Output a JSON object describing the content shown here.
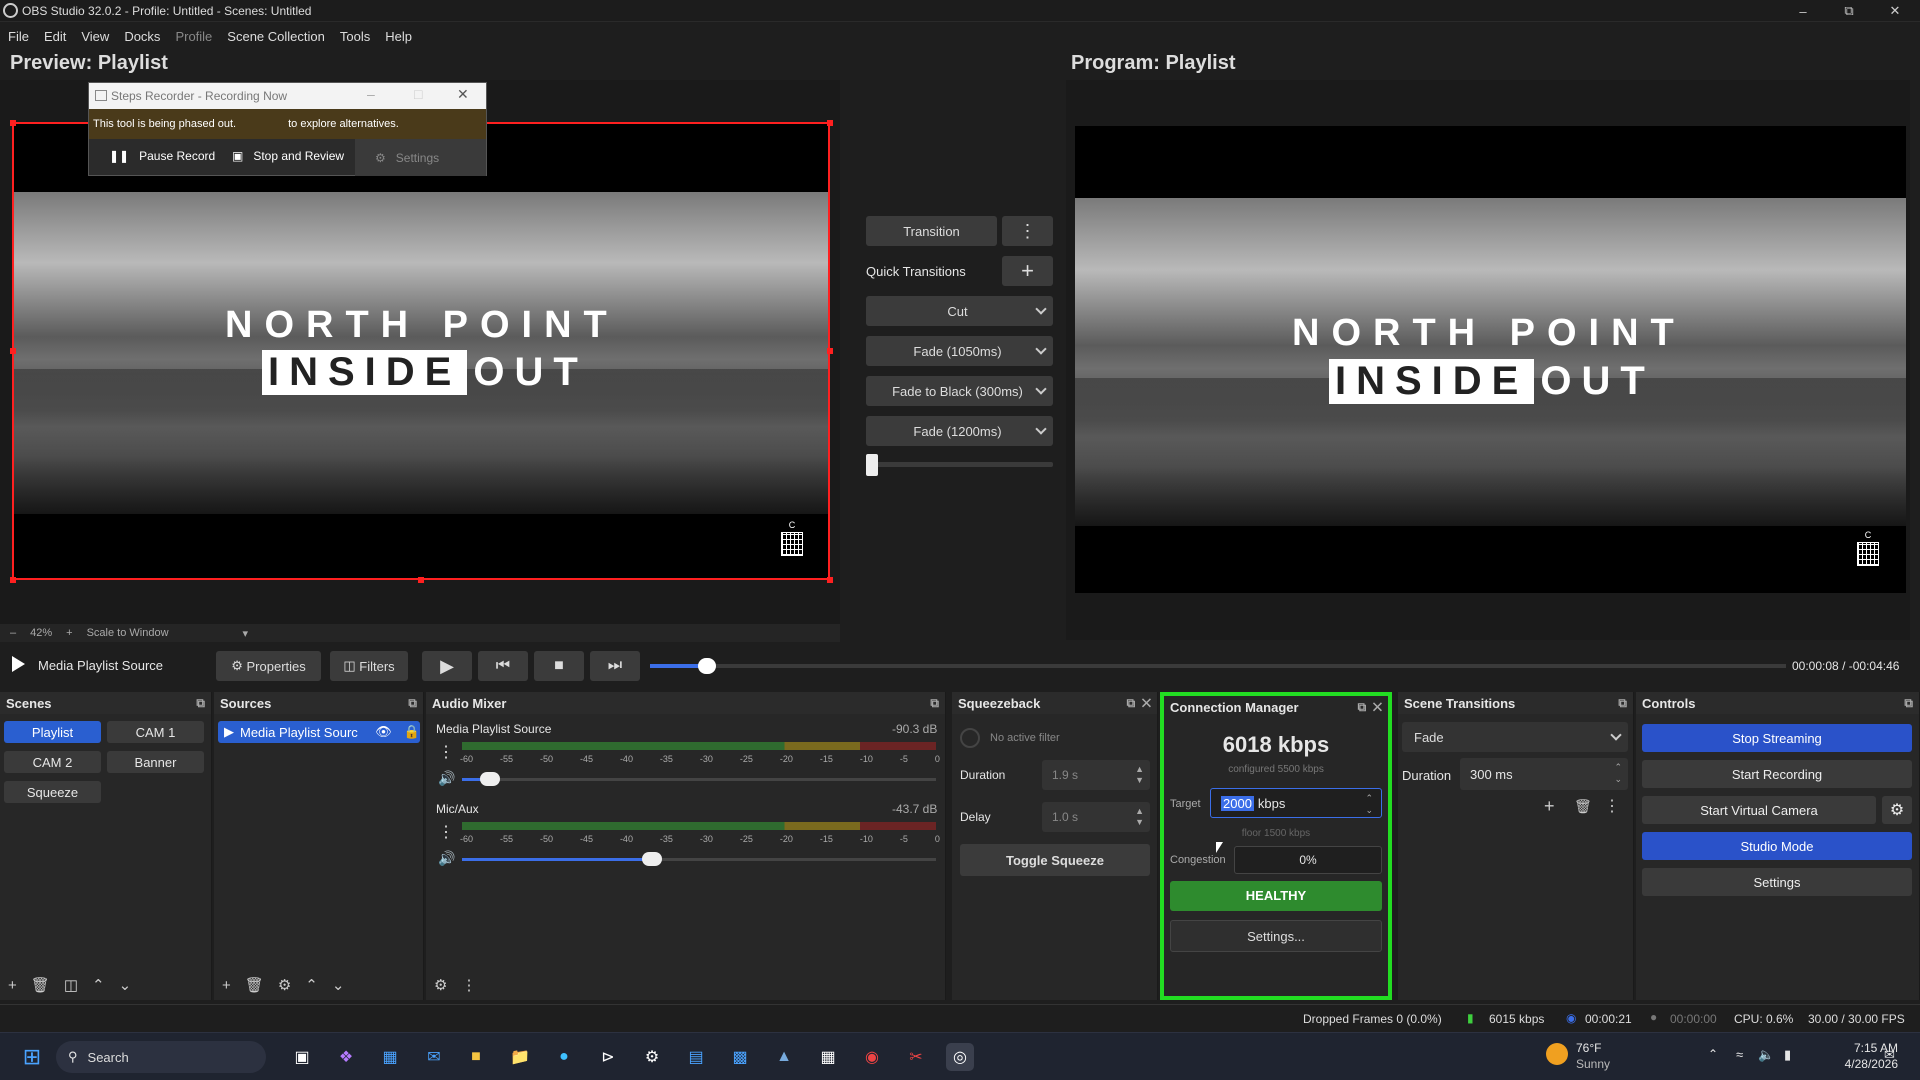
{
  "window": {
    "title": "OBS Studio 32.0.2 - Profile: Untitled - Scenes: Untitled"
  },
  "menu": [
    "File",
    "Edit",
    "View",
    "Docks",
    "Profile",
    "Scene Collection",
    "Tools",
    "Help"
  ],
  "preview": {
    "title": "Preview: Playlist",
    "zoom": "42%",
    "scale_mode": "Scale to Window"
  },
  "program": {
    "title": "Program: Playlist"
  },
  "video": {
    "line1": "NORTH POINT",
    "inside": "INSIDE",
    "out": "OUT",
    "chord": "C"
  },
  "steps_recorder": {
    "title": "Steps Recorder - Recording Now",
    "notice_a": "This tool is being phased out.",
    "notice_b": "to explore alternatives.",
    "pause": "Pause Record",
    "stop": "Stop and Review",
    "settings": "Settings"
  },
  "transitions_panel": {
    "transition": "Transition",
    "quick": "Quick Transitions",
    "items": [
      "Cut",
      "Fade (1050ms)",
      "Fade to Black (300ms)",
      "Fade (1200ms)"
    ]
  },
  "media_bar": {
    "source": "Media Playlist Source",
    "properties": "Properties",
    "filters": "Filters",
    "time": "00:00:08",
    "sep": "/",
    "remaining": "-00:04:46",
    "progress": 0.05
  },
  "scenes": {
    "title": "Scenes",
    "items": [
      "Playlist",
      "CAM 1",
      "CAM 2",
      "Banner",
      "Squeeze"
    ]
  },
  "sources": {
    "title": "Sources",
    "items": [
      "Media Playlist Sourc"
    ]
  },
  "audio_mixer": {
    "title": "Audio Mixer",
    "channels": [
      {
        "name": "Media Playlist Source",
        "db": "-90.3 dB",
        "volume": 0.06
      },
      {
        "name": "Mic/Aux",
        "db": "-43.7 dB",
        "volume": 0.4
      }
    ],
    "ticks": [
      "-60",
      "-55",
      "-50",
      "-45",
      "-40",
      "-35",
      "-30",
      "-25",
      "-20",
      "-15",
      "-10",
      "-5",
      "0"
    ]
  },
  "squeezeback": {
    "title": "Squeezeback",
    "no_filter": "No active filter",
    "duration_label": "Duration",
    "duration": "1.9 s",
    "delay_label": "Delay",
    "delay": "1.0 s",
    "toggle": "Toggle Squeeze"
  },
  "connection": {
    "title": "Connection Manager",
    "kbps": "6018 kbps",
    "configured": "configured 5500 kbps",
    "target_label": "Target",
    "target_sel": "2000",
    "target_unit": "kbps",
    "floor": "floor 1500 kbps",
    "congestion_label": "Congestion",
    "congestion": "0%",
    "status": "HEALTHY",
    "settings": "Settings..."
  },
  "scene_transitions": {
    "title": "Scene Transitions",
    "type": "Fade",
    "duration_label": "Duration",
    "duration": "300 ms"
  },
  "controls": {
    "title": "Controls",
    "stop_streaming": "Stop Streaming",
    "start_recording": "Start Recording",
    "virtual_camera": "Start Virtual Camera",
    "studio_mode": "Studio Mode",
    "settings": "Settings"
  },
  "status": {
    "dropped": "Dropped Frames 0 (0.0%)",
    "bitrate": "6015 kbps",
    "stream_time": "00:00:21",
    "rec_time": "00:00:00",
    "cpu": "CPU: 0.6%",
    "fps": "30.00 / 30.00 FPS"
  },
  "taskbar": {
    "search": "Search",
    "temp": "76°F",
    "weather": "Sunny",
    "time": "7:15 AM",
    "date": "4/28/2026"
  },
  "colors": {
    "accent_blue": "#2a52c9",
    "healthy_green": "#2e8b2e",
    "highlight_green": "#22dd22",
    "selection_red": "#ff2020"
  }
}
